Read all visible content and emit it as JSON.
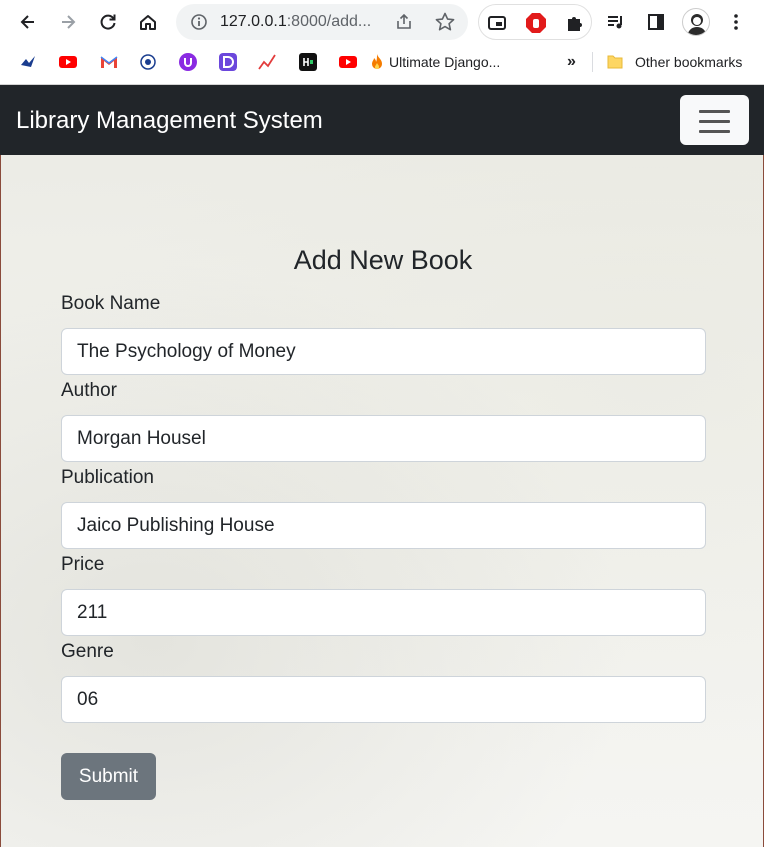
{
  "browser": {
    "url_host": "127.0.0.1",
    "url_rest": ":8000/add...",
    "bookmarks": [
      {
        "icon": "site-icon",
        "label": ""
      },
      {
        "icon": "youtube-icon",
        "label": ""
      },
      {
        "icon": "gmail-icon",
        "label": ""
      },
      {
        "icon": "site-icon",
        "label": ""
      },
      {
        "icon": "site-icon",
        "label": ""
      },
      {
        "icon": "site-icon",
        "label": ""
      },
      {
        "icon": "trend-icon",
        "label": ""
      },
      {
        "icon": "hackerrank-icon",
        "label": ""
      },
      {
        "icon": "youtube-icon",
        "label": ""
      },
      {
        "icon": "fire-icon",
        "label": "Ultimate Django..."
      }
    ],
    "more_bookmarks": "»",
    "other_bookmarks": "Other bookmarks"
  },
  "navbar": {
    "brand": "Library Management System"
  },
  "form": {
    "title": "Add New Book",
    "fields": [
      {
        "label": "Book Name",
        "value": "The Psychology of Money"
      },
      {
        "label": "Author",
        "value": "Morgan Housel"
      },
      {
        "label": "Publication",
        "value": "Jaico Publishing House"
      },
      {
        "label": "Price",
        "value": "211"
      },
      {
        "label": "Genre",
        "value": "06"
      }
    ],
    "submit_label": "Submit"
  },
  "colors": {
    "navbar_bg": "#212529",
    "submit_bg": "#6c757d"
  }
}
